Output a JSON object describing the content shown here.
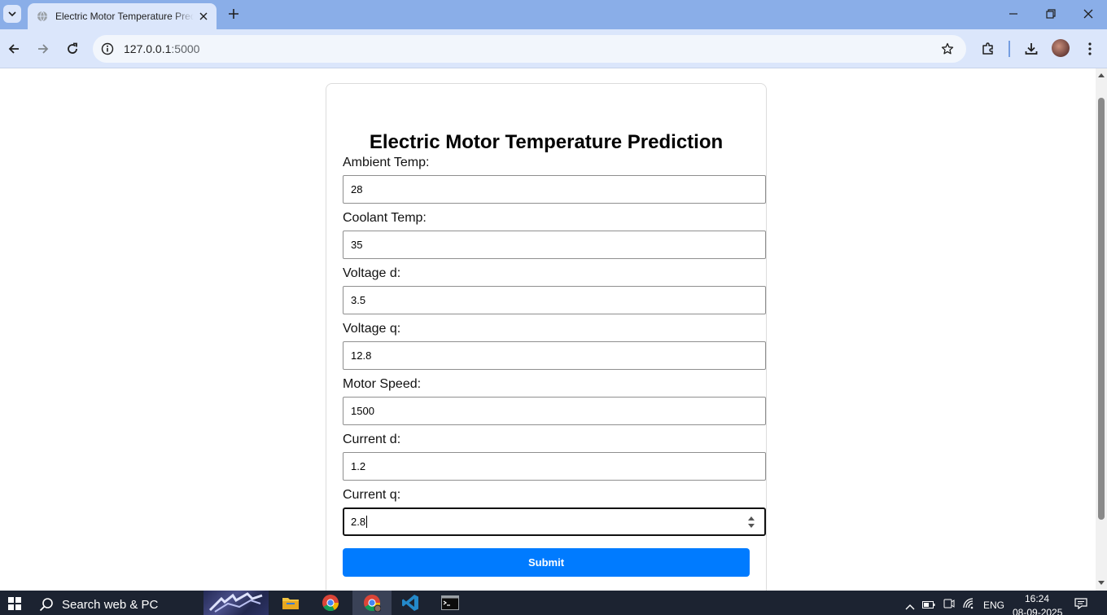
{
  "browser": {
    "tab_title": "Electric Motor Temperature Prediction",
    "url_host": "127.0.0.1",
    "url_port": ":5000"
  },
  "form": {
    "title": "Electric Motor Temperature Prediction",
    "fields": [
      {
        "label": "Ambient Temp:",
        "value": "28"
      },
      {
        "label": "Coolant Temp:",
        "value": "35"
      },
      {
        "label": "Voltage d:",
        "value": "3.5"
      },
      {
        "label": "Voltage q:",
        "value": "12.8"
      },
      {
        "label": "Motor Speed:",
        "value": "1500"
      },
      {
        "label": "Current d:",
        "value": "1.2"
      },
      {
        "label": "Current q:",
        "value": "2.8"
      }
    ],
    "submit_label": "Submit",
    "accent_color": "#007bff"
  },
  "taskbar": {
    "search_placeholder": "Search web & PC",
    "language": "ENG",
    "time": "16:24",
    "date": "08-09-2025"
  }
}
